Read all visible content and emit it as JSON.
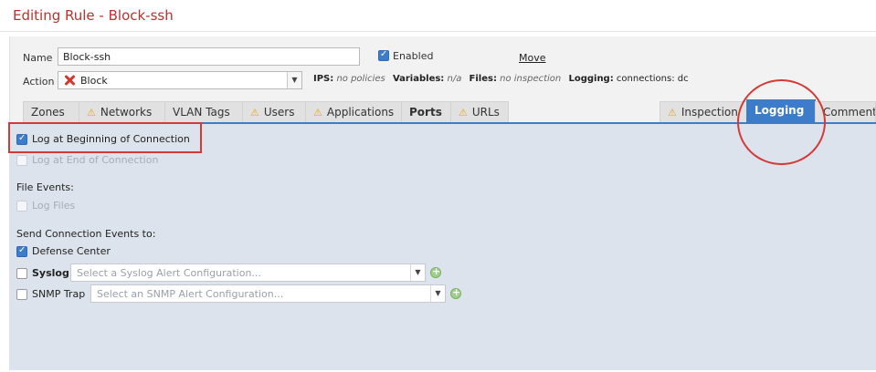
{
  "window": {
    "title": "Editing Rule - Block-ssh"
  },
  "rule": {
    "name_label": "Name",
    "name_value": "Block-ssh",
    "enabled_label": "Enabled",
    "move_link": "Move",
    "action_label": "Action",
    "action_value": "Block"
  },
  "summary": {
    "ips_label": "IPS:",
    "ips_value": "no policies",
    "variables_label": "Variables:",
    "variables_value": "n/a",
    "files_label": "Files:",
    "files_value": "no inspection",
    "logging_label": "Logging:",
    "logging_value": "connections: dc"
  },
  "tabs": [
    {
      "label": "Zones",
      "warning": false
    },
    {
      "label": "Networks",
      "warning": true
    },
    {
      "label": "VLAN Tags",
      "warning": false
    },
    {
      "label": "Users",
      "warning": true
    },
    {
      "label": "Applications",
      "warning": true
    },
    {
      "label": "Ports",
      "warning": false
    },
    {
      "label": "URLs",
      "warning": true
    },
    {
      "label": "Inspection",
      "warning": true
    },
    {
      "label": "Logging",
      "warning": false,
      "active": true
    },
    {
      "label": "Comment",
      "warning": false
    }
  ],
  "logging": {
    "log_beginning": "Log at Beginning of Connection",
    "log_end": "Log at End of Connection",
    "file_events_heading": "File Events:",
    "log_files": "Log Files",
    "send_events_heading": "Send Connection Events to:",
    "defense_center": "Defense Center",
    "syslog_label": "Syslog",
    "syslog_placeholder": "Select a Syslog Alert Configuration...",
    "snmp_label": "SNMP Trap",
    "snmp_placeholder": "Select an SNMP Alert Configuration..."
  },
  "colors": {
    "title": "#b8322e",
    "accent": "#3d7cc9",
    "annotation": "#d33a36",
    "warning": "#e8a42a"
  }
}
